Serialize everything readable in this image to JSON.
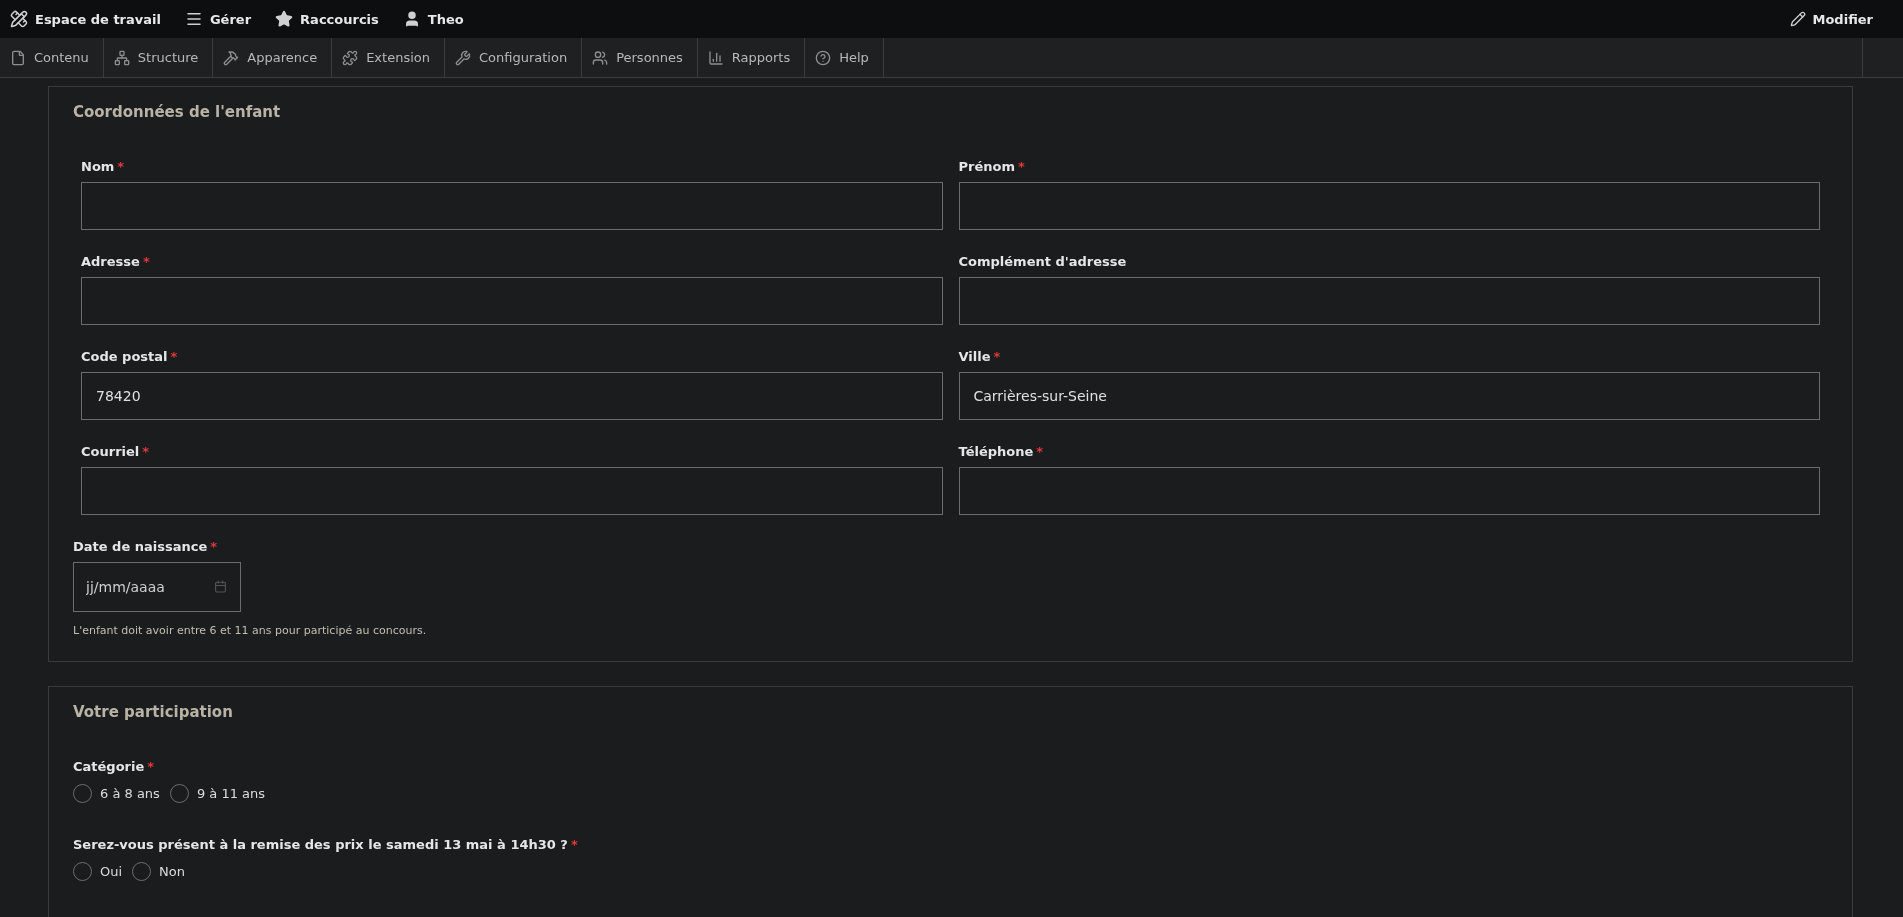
{
  "toolbar": {
    "items": [
      {
        "label": "Espace de travail"
      },
      {
        "label": "Gérer"
      },
      {
        "label": "Raccourcis"
      },
      {
        "label": "Theo"
      }
    ],
    "edit": {
      "label": "Modifier"
    }
  },
  "admin_menu": [
    {
      "label": "Contenu"
    },
    {
      "label": "Structure"
    },
    {
      "label": "Apparence"
    },
    {
      "label": "Extension"
    },
    {
      "label": "Configuration"
    },
    {
      "label": "Personnes"
    },
    {
      "label": "Rapports"
    },
    {
      "label": "Help"
    }
  ],
  "sections": [
    {
      "legend": "Coordonnées de l'enfant",
      "fields": [
        {
          "kind": "text",
          "label": "Nom",
          "asterisk": "*"
        },
        {
          "kind": "text",
          "label": "Prénom",
          "asterisk": "*"
        },
        {
          "kind": "text",
          "label": "Adresse",
          "asterisk": "*"
        },
        {
          "kind": "text",
          "label": "Complément d'adresse"
        },
        {
          "kind": "text",
          "label": "Code postal",
          "asterisk": "*",
          "value": "78420"
        },
        {
          "kind": "text",
          "label": "Ville",
          "asterisk": "*",
          "value": "Carrières-sur-Seine"
        },
        {
          "kind": "text",
          "label": "Courriel",
          "asterisk": "*"
        },
        {
          "kind": "text",
          "label": "Téléphone",
          "asterisk": "*"
        },
        {
          "kind": "date",
          "label": "Date de naissance",
          "asterisk": "*",
          "placeholder": "jj/mm/aaaa",
          "help": "L'enfant doit avoir entre 6 et 11 ans pour participé au concours."
        }
      ]
    },
    {
      "legend": "Votre participation",
      "fields": [
        {
          "kind": "radios",
          "label": "Catégorie",
          "asterisk": "*",
          "options": [
            {
              "label": "6 à 8 ans",
              "selected": false
            },
            {
              "label": "9 à 11 ans",
              "selected": false
            }
          ]
        },
        {
          "kind": "radios",
          "label": "Serez-vous présent à la remise des prix le samedi 13 mai à 14h30 ?",
          "asterisk": "*",
          "options": [
            {
              "label": "Oui",
              "selected": false
            },
            {
              "label": "Non",
              "selected": false
            }
          ]
        }
      ]
    }
  ]
}
